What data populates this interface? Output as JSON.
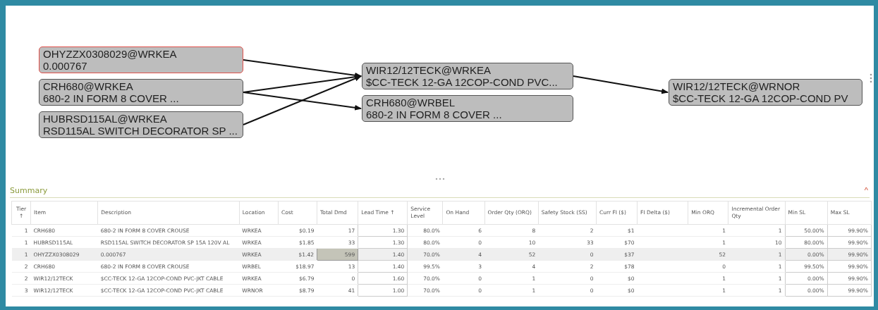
{
  "diagram": {
    "columns": [
      [
        {
          "line1": "OHYZZX0308029@WRKEA",
          "line2": "0.000767",
          "selected": true,
          "links": [
            true,
            false
          ]
        },
        {
          "line1": "CRH680@WRKEA",
          "line2": "680-2 IN FORM 8 COVER ...",
          "selected": false,
          "links": [
            true,
            true
          ]
        },
        {
          "line1": "HUBRSD115AL@WRKEA",
          "line2": "RSD115AL SWITCH DECORATOR SP ...",
          "selected": false,
          "links": [
            true,
            false
          ]
        }
      ],
      [
        {
          "line1": "WIR12/12TECK@WRKEA",
          "line2": "$CC-TECK 12-GA 12COP-COND PVC...",
          "selected": false,
          "links": [
            true
          ]
        },
        {
          "line1": "CRH680@WRBEL",
          "line2": "680-2 IN FORM 8 COVER ...",
          "selected": false
        }
      ],
      [
        {
          "line1": "WIR12/12TECK@WRNOR",
          "line2": "$CC-TECK 12-GA 12COP-COND PV",
          "selected": false
        }
      ]
    ]
  },
  "summary": {
    "title": "Summary",
    "expanded": true,
    "collapse_glyph": "^",
    "columns": [
      {
        "label": "Tier ↑",
        "editable": false
      },
      {
        "label": "Item",
        "editable": false
      },
      {
        "label": "Description",
        "editable": false
      },
      {
        "label": "Location",
        "editable": false
      },
      {
        "label": "Cost",
        "editable": false
      },
      {
        "label": "Total Dmd",
        "editable": false
      },
      {
        "label": "Lead Time ↑",
        "editable": true
      },
      {
        "label": "Service Level",
        "editable": false
      },
      {
        "label": "On Hand",
        "editable": false
      },
      {
        "label": "Order Qty (ORQ)",
        "editable": false
      },
      {
        "label": "Safety Stock (SS)",
        "editable": false
      },
      {
        "label": "Curr FI ($)",
        "editable": false
      },
      {
        "label": "FI Delta ($)",
        "editable": false
      },
      {
        "label": "Min ORQ",
        "editable": false
      },
      {
        "label": "Incremental Order Qty",
        "editable": false
      },
      {
        "label": "Min SL",
        "editable": true
      },
      {
        "label": "Max SL",
        "editable": true
      }
    ],
    "rows": [
      {
        "selected": false,
        "focused": false,
        "cells": [
          "1",
          "CRH680",
          "680-2 IN FORM 8 COVER CROUSE",
          "WRKEA",
          "$0.19",
          "17",
          "1.30",
          "80.0%",
          "6",
          "8",
          "2",
          "$1",
          null,
          "1",
          "1",
          "50.00%",
          "99.90%"
        ]
      },
      {
        "selected": false,
        "focused": false,
        "cells": [
          "1",
          "HUBRSD115AL",
          "RSD115AL SWITCH DECORATOR SP 15A 120V AL",
          "WRKEA",
          "$1.85",
          "33",
          "1.30",
          "80.0%",
          "0",
          "10",
          "33",
          "$70",
          null,
          "1",
          "10",
          "80.00%",
          "99.90%"
        ]
      },
      {
        "selected": true,
        "focused": true,
        "cells": [
          "1",
          "OHYZZX0308029",
          "0.000767",
          "WRKEA",
          "$1.42",
          "599",
          "1.40",
          "70.0%",
          "4",
          "52",
          "0",
          "$37",
          null,
          "52",
          "1",
          "0.00%",
          "99.90%"
        ]
      },
      {
        "selected": false,
        "focused": false,
        "cells": [
          "2",
          "CRH680",
          "680-2 IN FORM 8 COVER CROUSE",
          "WRBEL",
          "$18.97",
          "13",
          "1.40",
          "99.5%",
          "3",
          "4",
          "2",
          "$78",
          null,
          "0",
          "1",
          "99.50%",
          "99.90%"
        ]
      },
      {
        "selected": false,
        "focused": false,
        "cells": [
          "2",
          "WIR12/12TECK",
          "$CC-TECK 12-GA 12COP-COND PVC-JKT CABLE",
          "WRKEA",
          "$6.79",
          "0",
          "1.60",
          "70.0%",
          "0",
          "1",
          "0",
          "$0",
          null,
          "1",
          "1",
          "0.00%",
          "99.90%"
        ]
      },
      {
        "selected": false,
        "focused": false,
        "cells": [
          "3",
          "WIR12/12TECK",
          "$CC-TECK 12-GA 12COP-COND PVC-JKT CABLE",
          "WRNOR",
          "$8.79",
          "41",
          "1.00",
          "70.0%",
          "0",
          "1",
          "0",
          "$0",
          null,
          "1",
          "1",
          "0.00%",
          "99.90%"
        ]
      }
    ]
  }
}
